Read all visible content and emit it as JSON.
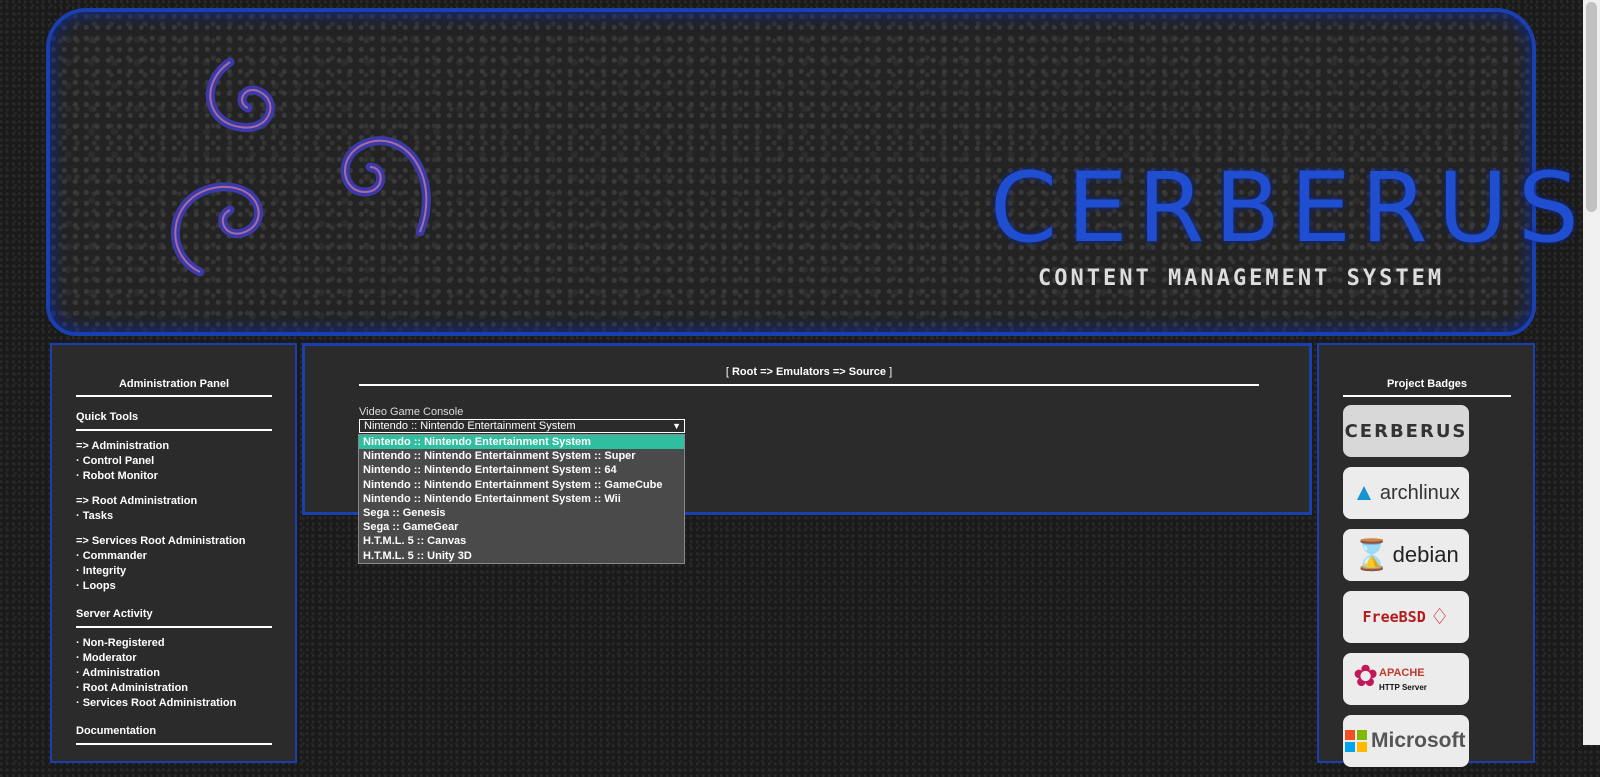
{
  "banner": {
    "title": "CERBERUS",
    "subtitle": "CONTENT MANAGEMENT SYSTEM"
  },
  "left_panel": {
    "title": "Administration Panel",
    "quick_tools": {
      "heading": "Quick Tools",
      "groups": [
        {
          "items": [
            "=> Administration",
            "· Control Panel",
            "· Robot Monitor"
          ]
        },
        {
          "items": [
            "=> Root Administration",
            "· Tasks"
          ]
        },
        {
          "items": [
            "=> Services Root Administration",
            "· Commander",
            "· Integrity",
            "· Loops"
          ]
        }
      ]
    },
    "server_activity": {
      "heading": "Server Activity",
      "items": [
        "· Non-Registered",
        "· Moderator",
        "· Administration",
        "· Root Administration",
        "· Services Root Administration"
      ]
    },
    "documentation": {
      "heading": "Documentation"
    }
  },
  "main": {
    "breadcrumb_open": "[ ",
    "breadcrumb_path": "Root => Emulators => Source",
    "breadcrumb_close": " ]",
    "field_label": "Video Game Console",
    "select_value": "Nintendo :: Nintendo Entertainment System",
    "options": [
      "Nintendo :: Nintendo Entertainment System",
      "Nintendo :: Nintendo Entertainment System :: Super",
      "Nintendo :: Nintendo Entertainment System :: 64",
      "Nintendo :: Nintendo Entertainment System :: GameCube",
      "Nintendo :: Nintendo Entertainment System :: Wii",
      "Sega :: Genesis",
      "Sega :: GameGear",
      "H.T.M.L. 5 :: Canvas",
      "H.T.M.L. 5 :: Unity 3D"
    ]
  },
  "right_panel": {
    "title": "Project Badges",
    "badges": [
      "CERBERUS",
      "archlinux",
      "debian",
      "FreeBSD",
      "APACHE",
      "HTTP Server",
      "Microsoft"
    ]
  },
  "colors": {
    "accent_blue": "#1a3fb0",
    "selected_option": "#2fbfa0"
  }
}
